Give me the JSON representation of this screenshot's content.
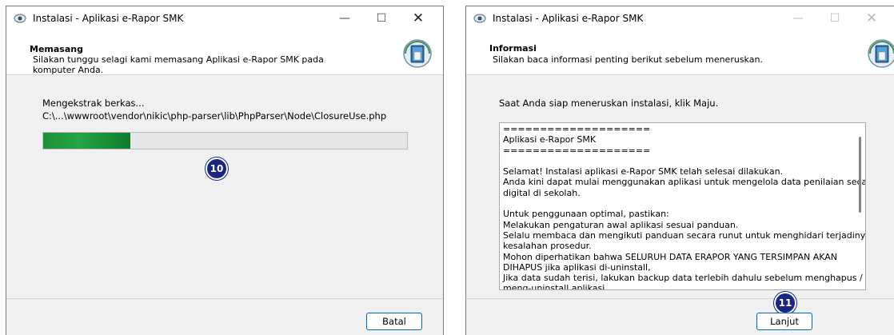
{
  "installer_left": {
    "title": "Instalasi - Aplikasi e-Rapor SMK",
    "window_controls": {
      "minimize": "—",
      "maximize": "☐",
      "close": "✕"
    },
    "header": {
      "title": "Memasang",
      "subtitle": "Silakan tunggu selagi kami memasang Aplikasi e-Rapor SMK pada komputer Anda."
    },
    "status_label": "Mengekstrak berkas...",
    "file_path": "C:\\...\\wwwroot\\vendor\\nikic\\php-parser\\lib\\PhpParser\\Node\\ClosureUse.php",
    "progress_percent": 24,
    "cancel_label": "Batal",
    "step_badge": "10"
  },
  "installer_right": {
    "title": "Instalasi - Aplikasi e-Rapor SMK",
    "window_controls": {
      "minimize": "—",
      "maximize": "☐",
      "close": "✕"
    },
    "header": {
      "title": "Informasi",
      "subtitle": "Silakan baca informasi penting berikut sebelum meneruskan."
    },
    "instruction": "Saat Anda siap meneruskan instalasi, klik Maju.",
    "info_lines": [
      "====================",
      "Aplikasi e-Rapor SMK",
      "====================",
      "",
      "Selamat! Instalasi aplikasi e-Rapor SMK telah selesai dilakukan.",
      "Anda kini dapat mulai menggunakan aplikasi untuk mengelola data penilaian secara",
      "digital di sekolah.",
      "",
      "Untuk penggunaan optimal, pastikan:",
      "Melakukan pengaturan awal aplikasi sesuai panduan.",
      "Selalu membaca dan mengikuti panduan secara runut untuk menghidari terjadinya",
      "kesalahan prosedur.",
      "Mohon diperhatikan bahwa SELURUH DATA ERAPOR YANG TERSIMPAN AKAN",
      "DIHAPUS jika aplikasi di-uninstall,",
      "Jika data sudah terisi, lakukan backup data terlebih dahulu sebelum menghapus /",
      "meng-uninstall aplikasi."
    ],
    "next_label": "Lanjut",
    "step_badge": "11"
  },
  "colors": {
    "progress_green": "#26a544",
    "badge_navy": "#1a2680",
    "button_border": "#0067c0"
  },
  "icons": [
    "app-icon",
    "installer-logo-icon",
    "minimize-icon",
    "maximize-icon",
    "close-icon"
  ]
}
